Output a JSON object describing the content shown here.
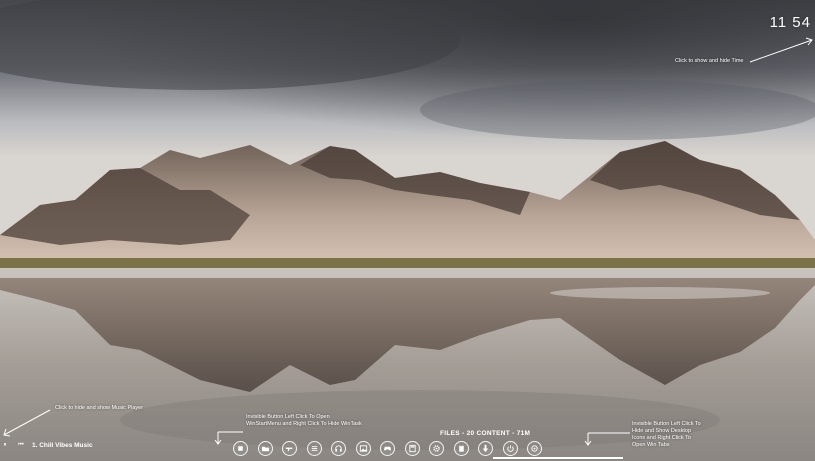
{
  "clock": {
    "time": "11 54"
  },
  "hints": {
    "time": "Click to show and hide Time",
    "music": "Click to hide and show Music Player",
    "start_menu": "Invisible Button Left Click To Open WinStartMenu and Right Click To Hide WinTask",
    "desktop": "Invisible Button Left Click To Hide and Show Desktop Icons and Right Click To Open Win Tabs"
  },
  "music_player": {
    "track": "1. Chill Vibes Music",
    "controls": [
      {
        "name": "play-pause",
        "glyph": "⏸"
      },
      {
        "name": "previous",
        "glyph": "⏮"
      }
    ]
  },
  "stats": {
    "label": "FILES - 20  CONTENT - 71M"
  },
  "dock": {
    "icons": [
      "stop-icon",
      "folder-icon",
      "gun-icon",
      "list-icon",
      "headphones-icon",
      "image-icon",
      "gamepad-icon",
      "calculator-icon",
      "settings-icon",
      "trash-icon",
      "download-icon",
      "power-icon",
      "disc-icon"
    ]
  },
  "colors": {
    "accent": "#ffffff",
    "sky": "#9ea3ab",
    "water": "#a8a8a8"
  }
}
